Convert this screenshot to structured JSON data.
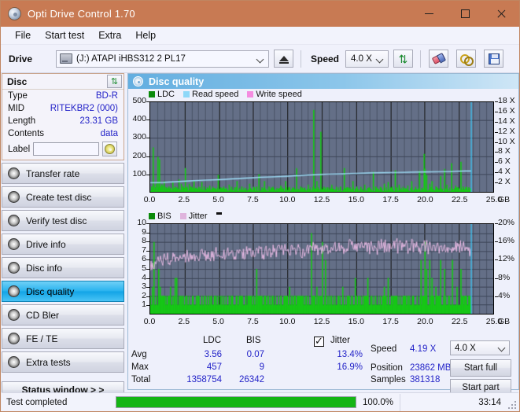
{
  "window": {
    "title": "Opti Drive Control 1.70",
    "icon": "disc-icon",
    "minimize": "–",
    "maximize": "□",
    "close": "✕"
  },
  "menu": {
    "items": [
      {
        "label": "File"
      },
      {
        "label": "Start test"
      },
      {
        "label": "Extra"
      },
      {
        "label": "Help"
      }
    ]
  },
  "toolbar": {
    "drive_label": "Drive",
    "drive_value": "(J:)  ATAPI iHBS312   2 PL17",
    "eject_icon": "eject-icon",
    "speed_label": "Speed",
    "speed_value": "4.0 X",
    "refresh_icon": "refresh-icon",
    "erase_icon": "eraser-icon",
    "chain_icon": "chain-icon",
    "save_icon": "floppy-save-icon"
  },
  "disc_panel": {
    "header": "Disc",
    "refresh_icon": "refresh-icon",
    "rows": [
      {
        "key": "Type",
        "value": "BD-R"
      },
      {
        "key": "MID",
        "value": "RITEKBR2 (000)"
      },
      {
        "key": "Length",
        "value": "23.31 GB"
      },
      {
        "key": "Contents",
        "value": "data"
      }
    ],
    "label_key": "Label",
    "label_value": "",
    "label_placeholder": "",
    "label_button_icon": "cd-icon"
  },
  "nav": {
    "items": [
      {
        "label": "Transfer rate",
        "icon": "disc-icon",
        "active": false
      },
      {
        "label": "Create test disc",
        "icon": "disc-icon",
        "active": false
      },
      {
        "label": "Verify test disc",
        "icon": "disc-icon",
        "active": false
      },
      {
        "label": "Drive info",
        "icon": "disc-icon",
        "active": false
      },
      {
        "label": "Disc info",
        "icon": "disc-icon",
        "active": false
      },
      {
        "label": "Disc quality",
        "icon": "disc-icon",
        "active": true
      },
      {
        "label": "CD Bler",
        "icon": "disc-icon",
        "active": false
      },
      {
        "label": "FE / TE",
        "icon": "disc-icon",
        "active": false
      },
      {
        "label": "Extra tests",
        "icon": "disc-icon",
        "active": false
      }
    ],
    "status_window": "Status window > >"
  },
  "content": {
    "header_title": "Disc quality",
    "header_icon": "disc-icon"
  },
  "stats": {
    "col_headers": [
      "LDC",
      "BIS"
    ],
    "row_labels": [
      "Avg",
      "Max",
      "Total"
    ],
    "ldc": {
      "avg": "3.56",
      "max": "457",
      "total": "1358754"
    },
    "bis": {
      "avg": "0.07",
      "max": "9",
      "total": "26342"
    },
    "jitter": {
      "label": "Jitter",
      "checked": true,
      "avg": "13.4%",
      "max": "16.9%"
    },
    "speed_label": "Speed",
    "speed_value": "4.19 X",
    "position_label": "Position",
    "position_value": "23862 MB",
    "samples_label": "Samples",
    "samples_value": "381318",
    "speed_select": "4.0 X",
    "start_full": "Start full",
    "start_part": "Start part"
  },
  "statusbar": {
    "text": "Test completed",
    "progress_pct": "100.0%",
    "progress_value": 100,
    "elapsed": "33:14"
  },
  "colors": {
    "titlebar": "#c87a53",
    "accent_blue": "#2323c8",
    "plot_bg": "#646f87",
    "ldc_green": "#16c616",
    "read_speed": "#8ed8f8",
    "write_speed": "#f48ce0",
    "jitter_pink": "#dfb4dd",
    "progress_green": "#15b515",
    "nav_active": "#2ab3ef"
  },
  "chart_data": [
    {
      "type": "line",
      "name": "disc-quality-ldc-chart",
      "title": "",
      "xlabel": "GB",
      "ylabel": "",
      "xlim": [
        0,
        25.0
      ],
      "ylim": [
        0,
        500
      ],
      "y2lim": [
        0,
        18
      ],
      "y2label": "X",
      "grid": true,
      "legend_position": "top-left",
      "legend": [
        {
          "label": "LDC",
          "color": "#0a8a0a",
          "swatch": "green"
        },
        {
          "label": "Read speed",
          "color": "#8ed8f8",
          "swatch": "lightblue"
        },
        {
          "label": "Write speed",
          "color": "#f48ce0",
          "swatch": "pink"
        }
      ],
      "xticks": [
        "0.0",
        "2.5",
        "5.0",
        "7.5",
        "10.0",
        "12.5",
        "15.0",
        "17.5",
        "20.0",
        "22.5",
        "25.0"
      ],
      "yticks": [
        "100",
        "200",
        "300",
        "400",
        "500"
      ],
      "y2ticks": [
        "2 X",
        "4 X",
        "6 X",
        "8 X",
        "10 X",
        "12 X",
        "14 X",
        "16 X",
        "18 X"
      ],
      "series": [
        {
          "name": "LDC",
          "color": "#16c616",
          "kind": "impulse",
          "x": [
            0.05,
            0.15,
            0.25,
            0.32,
            0.4,
            0.5,
            0.6,
            0.7,
            0.78,
            0.85,
            0.95,
            1.05,
            1.15,
            1.3,
            1.45,
            1.6,
            1.75,
            1.9,
            2.05,
            2.2,
            2.35,
            2.5,
            2.65,
            2.8,
            2.9,
            3.0,
            3.15,
            3.3,
            3.5,
            3.7,
            3.9,
            4.1,
            4.3,
            4.5,
            4.7,
            4.9,
            5.1,
            5.3,
            5.5,
            5.7,
            5.9,
            6.1,
            6.3,
            6.6,
            6.9,
            7.2,
            7.5,
            7.7,
            7.9,
            8.1,
            8.3,
            8.6,
            8.9,
            9.2,
            9.5,
            9.8,
            10.1,
            10.4,
            10.6,
            10.9,
            11.2,
            11.5,
            11.8,
            11.9,
            12.1,
            12.4,
            12.6,
            12.9,
            13.2,
            13.5,
            13.8,
            14.1,
            14.4,
            14.7,
            15.0,
            15.3,
            15.6,
            15.9,
            16.2,
            16.4,
            16.7,
            17.0,
            17.3,
            17.6,
            17.8,
            18.1,
            18.4,
            18.7,
            19.0,
            19.3,
            19.6,
            19.9,
            20.0,
            20.1,
            20.3,
            20.5,
            20.8,
            21.1,
            21.4,
            21.6,
            21.9,
            22.2,
            22.4,
            22.6,
            22.8,
            23.0,
            23.2,
            23.3
          ],
          "values": [
            30,
            248,
            40,
            25,
            45,
            196,
            180,
            30,
            42,
            35,
            60,
            28,
            25,
            30,
            22,
            55,
            30,
            25,
            70,
            45,
            30,
            133,
            28,
            44,
            30,
            25,
            60,
            22,
            28,
            55,
            30,
            25,
            35,
            28,
            20,
            95,
            25,
            30,
            22,
            40,
            28,
            25,
            60,
            30,
            22,
            45,
            28,
            30,
            98,
            25,
            60,
            30,
            28,
            22,
            35,
            60,
            28,
            25,
            132,
            30,
            22,
            40,
            28,
            457,
            60,
            335,
            30,
            25,
            40,
            28,
            30,
            133,
            25,
            60,
            30,
            28,
            40,
            25,
            112,
            30,
            28,
            45,
            55,
            30,
            120,
            40,
            28,
            35,
            60,
            28,
            118,
            212,
            130,
            95,
            45,
            60,
            30,
            88,
            128,
            40,
            160,
            35,
            25,
            168,
            30,
            28,
            25,
            20
          ]
        },
        {
          "name": "Read speed",
          "color": "#8ed8f8",
          "kind": "line",
          "x": [
            0.0,
            1.0,
            2.0,
            3.0,
            4.0,
            5.0,
            6.0,
            7.0,
            8.0,
            9.0,
            10.0,
            11.0,
            12.0,
            12.5,
            13.0,
            14.0,
            15.0,
            16.0,
            17.0,
            18.0,
            19.0,
            20.0,
            21.0,
            22.0,
            23.0,
            23.4
          ],
          "values_x_multiple": [
            1.85,
            1.9,
            2.05,
            2.2,
            2.35,
            2.45,
            2.6,
            2.75,
            2.9,
            3.0,
            3.15,
            3.3,
            3.45,
            3.5,
            3.55,
            3.6,
            3.7,
            3.8,
            3.85,
            3.9,
            3.95,
            4.0,
            4.05,
            4.1,
            4.19,
            4.19
          ]
        },
        {
          "name": "Write speed",
          "color": "#f48ce0",
          "kind": "line",
          "x": [],
          "values": []
        },
        {
          "name": "end-marker",
          "color": "#39c5f3",
          "kind": "vline",
          "x": [
            23.4
          ]
        }
      ]
    },
    {
      "type": "line",
      "name": "disc-quality-bis-jitter-chart",
      "title": "",
      "xlabel": "GB",
      "ylabel": "",
      "xlim": [
        0,
        25.0
      ],
      "ylim": [
        0,
        10
      ],
      "y2lim": [
        0,
        20
      ],
      "y2label": "%",
      "grid": true,
      "legend_position": "top-left",
      "legend": [
        {
          "label": "BIS",
          "color": "#0a8a0a",
          "swatch": "green"
        },
        {
          "label": "Jitter",
          "color": "#dfb4dd",
          "swatch": "pink"
        }
      ],
      "xticks": [
        "0.0",
        "2.5",
        "5.0",
        "7.5",
        "10.0",
        "12.5",
        "15.0",
        "17.5",
        "20.0",
        "22.5",
        "25.0"
      ],
      "yticks": [
        "1",
        "2",
        "3",
        "4",
        "5",
        "6",
        "7",
        "8",
        "9",
        "10"
      ],
      "y2ticks": [
        "4%",
        "8%",
        "12%",
        "16%",
        "20%"
      ],
      "series": [
        {
          "name": "BIS",
          "color": "#16c616",
          "kind": "impulse",
          "baseline": 1,
          "x": [
            0.1,
            0.25,
            0.4,
            0.55,
            0.7,
            0.85,
            1.0,
            1.15,
            1.3,
            1.45,
            1.6,
            1.75,
            1.9,
            2.05,
            2.2,
            2.35,
            2.5,
            2.65,
            2.8,
            2.95,
            3.1,
            3.3,
            3.5,
            3.7,
            3.9,
            4.1,
            4.3,
            4.5,
            4.7,
            4.9,
            5.1,
            5.3,
            5.5,
            5.7,
            5.9,
            6.1,
            6.3,
            6.5,
            6.7,
            6.9,
            7.1,
            7.3,
            7.5,
            7.7,
            7.9,
            8.1,
            8.3,
            8.5,
            8.7,
            8.9,
            9.1,
            9.3,
            9.5,
            9.7,
            9.9,
            10.1,
            10.3,
            10.5,
            10.7,
            10.9,
            11.1,
            11.3,
            11.5,
            11.7,
            11.9,
            12.1,
            12.3,
            12.5,
            12.7,
            12.9,
            13.1,
            13.4,
            13.7,
            14.0,
            14.3,
            14.6,
            14.9,
            15.2,
            15.5,
            15.8,
            16.1,
            16.4,
            16.7,
            17.0,
            17.3,
            17.6,
            17.9,
            18.2,
            18.5,
            18.8,
            19.1,
            19.4,
            19.7,
            20.0,
            20.1,
            20.3,
            20.5,
            20.8,
            21.1,
            21.4,
            21.7,
            22.0,
            22.3,
            22.6,
            22.8,
            23.0,
            23.2
          ],
          "values": [
            3,
            8,
            2,
            5,
            3,
            2,
            2,
            1,
            2,
            3,
            2,
            4,
            4,
            2,
            2,
            1,
            2,
            2,
            2,
            1,
            2,
            2,
            2,
            2,
            2,
            2,
            2,
            1,
            2,
            2,
            2,
            2,
            2,
            2,
            2,
            1,
            2,
            2,
            2,
            2,
            2,
            2,
            2,
            5,
            2,
            2,
            2,
            2,
            1,
            2,
            2,
            2,
            2,
            2,
            2,
            3,
            2,
            2,
            2,
            1,
            2,
            2,
            2,
            9,
            2,
            3,
            2,
            8,
            6,
            2,
            2,
            2,
            2,
            3,
            2,
            2,
            4,
            2,
            2,
            4,
            2,
            2,
            2,
            3,
            4,
            2,
            2,
            2,
            2,
            2,
            2,
            2,
            6,
            8,
            5,
            6,
            4,
            3,
            6,
            5,
            2,
            6,
            3,
            5,
            2,
            2,
            2
          ]
        },
        {
          "name": "Jitter",
          "color": "#dfb4dd",
          "kind": "line",
          "unit": "%",
          "x_range": [
            0,
            23.4
          ],
          "mean": 13.4,
          "max": 16.9,
          "approx_band": [
            11.5,
            16.5
          ]
        },
        {
          "name": "end-marker",
          "color": "#39c5f3",
          "kind": "vline",
          "x": [
            23.4
          ]
        }
      ]
    }
  ]
}
